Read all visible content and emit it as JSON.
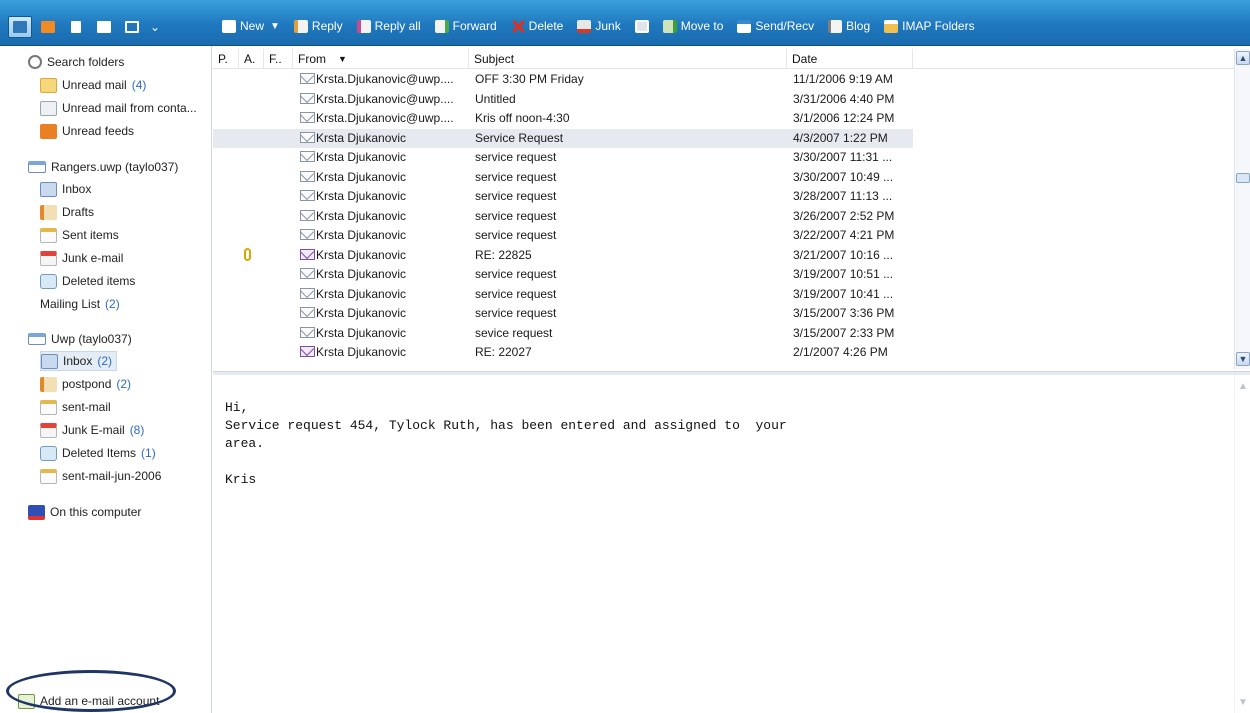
{
  "toolbar": {
    "left_icons": [
      "mail-view-icon",
      "rss-icon",
      "notes-icon",
      "columns-icon",
      "layout-icon"
    ],
    "chevron": "⌄",
    "new_label": "New",
    "reply_label": "Reply",
    "reply_all_label": "Reply all",
    "forward_label": "Forward",
    "delete_label": "Delete",
    "junk_label": "Junk",
    "move_to_label": "Move to",
    "send_recv_label": "Send/Recv",
    "blog_label": "Blog",
    "imap_label": "IMAP Folders"
  },
  "sidebar": {
    "search_label": "Search folders",
    "unread_mail": "Unread mail",
    "unread_mail_count": "(4)",
    "unread_from_contacts": "Unread mail from conta...",
    "unread_feeds": "Unread feeds",
    "account1": "Rangers.uwp (taylo037)",
    "account1_folders": [
      {
        "label": "Inbox",
        "count": ""
      },
      {
        "label": "Drafts",
        "count": ""
      },
      {
        "label": "Sent items",
        "count": ""
      },
      {
        "label": "Junk e-mail",
        "count": ""
      },
      {
        "label": "Deleted items",
        "count": ""
      },
      {
        "label": "Mailing List",
        "count": "(2)"
      }
    ],
    "account2": "Uwp (taylo037)",
    "account2_folders": [
      {
        "label": "Inbox",
        "count": "(2)"
      },
      {
        "label": "postpond",
        "count": "(2)"
      },
      {
        "label": "sent-mail",
        "count": ""
      },
      {
        "label": "Junk E-mail",
        "count": "(8)"
      },
      {
        "label": "Deleted Items",
        "count": "(1)"
      },
      {
        "label": "sent-mail-jun-2006",
        "count": ""
      }
    ],
    "on_this_computer": "On this computer",
    "add_account": "Add an e-mail account"
  },
  "list": {
    "headers": {
      "priority": "P.",
      "attachment": "A.",
      "flag": "F..",
      "from": "From",
      "from_sort": "▼",
      "subject": "Subject",
      "date": "Date"
    },
    "rows": [
      {
        "from": "Krsta.Djukanovic@uwp....",
        "subject": "OFF 3:30 PM Friday",
        "date": "11/1/2006 9:19 AM"
      },
      {
        "from": "Krsta.Djukanovic@uwp....",
        "subject": "Untitled",
        "date": "3/31/2006 4:40 PM"
      },
      {
        "from": "Krsta.Djukanovic@uwp....",
        "subject": "Kris off noon-4:30",
        "date": "3/1/2006 12:24 PM"
      },
      {
        "from": "Krsta Djukanovic",
        "subject": "Service Request",
        "date": "4/3/2007 1:22 PM"
      },
      {
        "from": "Krsta Djukanovic",
        "subject": "service request",
        "date": "3/30/2007 11:31 ..."
      },
      {
        "from": "Krsta Djukanovic",
        "subject": "service request",
        "date": "3/30/2007 10:49 ..."
      },
      {
        "from": "Krsta Djukanovic",
        "subject": "service request",
        "date": "3/28/2007 11:13 ..."
      },
      {
        "from": "Krsta Djukanovic",
        "subject": "service request",
        "date": "3/26/2007 2:52 PM"
      },
      {
        "from": "Krsta Djukanovic",
        "subject": "service request",
        "date": "3/22/2007 4:21 PM"
      },
      {
        "from": "Krsta Djukanovic",
        "subject": "RE: 22825",
        "date": "3/21/2007 10:16 ..."
      },
      {
        "from": "Krsta Djukanovic",
        "subject": "service request",
        "date": "3/19/2007 10:51 ..."
      },
      {
        "from": "Krsta Djukanovic",
        "subject": "service request",
        "date": "3/19/2007 10:41 ..."
      },
      {
        "from": "Krsta Djukanovic",
        "subject": "service request",
        "date": "3/15/2007 3:36 PM"
      },
      {
        "from": "Krsta Djukanovic",
        "subject": "sevice request",
        "date": "3/15/2007 2:33 PM"
      },
      {
        "from": "Krsta Djukanovic",
        "subject": "RE: 22027",
        "date": "2/1/2007 4:26 PM"
      }
    ]
  },
  "preview": {
    "body": "Hi,\nService request 454, Tylock Ruth, has been entered and assigned to  your\narea.\n\nKris"
  }
}
